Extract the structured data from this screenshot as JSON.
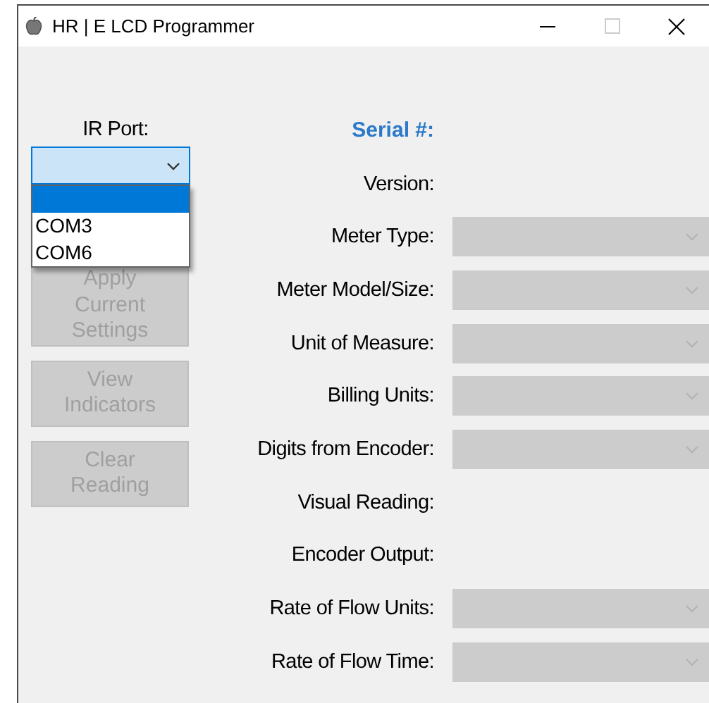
{
  "window": {
    "title": "HR | E LCD Programmer",
    "maximize_disabled": true
  },
  "ir_port": {
    "label": "IR Port:",
    "expanded": true,
    "options": [
      {
        "selected": true
      },
      {
        "label": "COM3",
        "selected": false
      },
      {
        "label": "COM6",
        "selected": false
      }
    ]
  },
  "buttons": [
    {
      "label": "Apply Current Settings",
      "disabled": true
    },
    {
      "label": "View Indicators",
      "disabled": true
    },
    {
      "label": "Clear Reading",
      "disabled": true
    }
  ],
  "fields": [
    {
      "kind": "heading",
      "label": "Serial #:"
    },
    {
      "kind": "label",
      "label": "Version:"
    },
    {
      "kind": "dropdown",
      "label": "Meter Type:",
      "disabled": true
    },
    {
      "kind": "dropdown",
      "label": "Meter Model/Size:",
      "disabled": true
    },
    {
      "kind": "dropdown",
      "label": "Unit of Measure:",
      "disabled": true
    },
    {
      "kind": "dropdown",
      "label": "Billing Units:",
      "disabled": true
    },
    {
      "kind": "dropdown",
      "label": "Digits from Encoder:",
      "disabled": true
    },
    {
      "kind": "label",
      "label": "Visual Reading:"
    },
    {
      "kind": "label",
      "label": "Encoder Output:"
    },
    {
      "kind": "dropdown",
      "label": "Rate of Flow Units:",
      "disabled": true
    },
    {
      "kind": "dropdown",
      "label": "Rate of Flow Time:",
      "disabled": true
    }
  ]
}
